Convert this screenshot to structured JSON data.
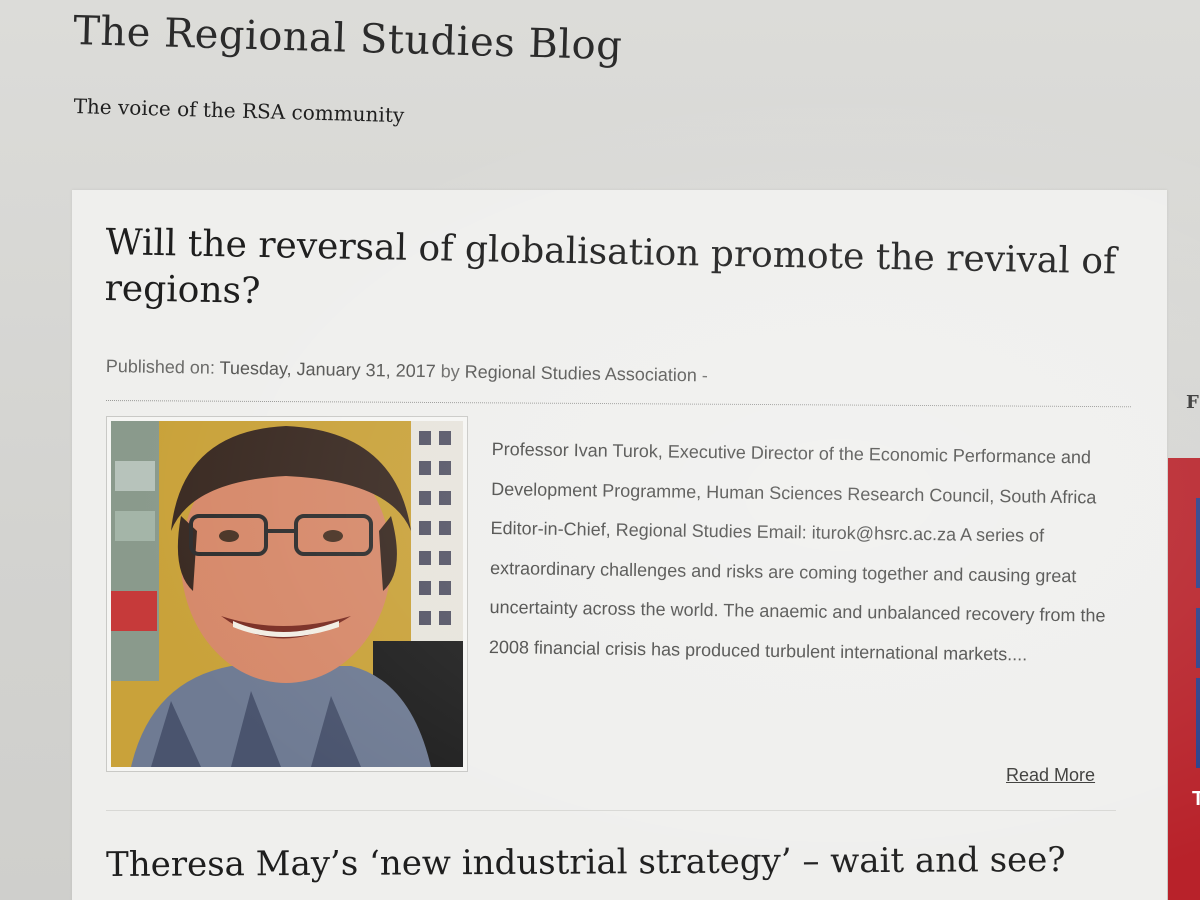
{
  "site": {
    "title": "The Regional Studies Blog",
    "tagline": "The voice of the RSA community"
  },
  "post": {
    "title": "Will the reversal of globalisation promote the revival of regions?",
    "meta_prefix": "Published on: ",
    "meta_date": "Tuesday, January 31, 2017",
    "meta_by": " by ",
    "meta_author": "Regional Studies Association",
    "meta_suffix": " -",
    "excerpt": "Professor Ivan Turok, Executive Director of the Economic Performance and Development Programme, Human Sciences Research Council, South Africa Editor-in-Chief, Regional Studies Email: iturok@hsrc.ac.za A series of extraordinary challenges and risks are coming together and causing great uncertainty across the world. The anaemic and unbalanced recovery from the 2008 financial crisis has produced turbulent international markets....",
    "read_more_label": "Read More"
  },
  "next_post": {
    "title": "Theresa May’s ‘new industrial strategy’ – wait and see?"
  },
  "sidebar": {
    "partial_heading": "F",
    "partial_banner_letter": "T"
  },
  "colors": {
    "banner_red": "#b8222a",
    "banner_blue": "#2a3f8a"
  }
}
